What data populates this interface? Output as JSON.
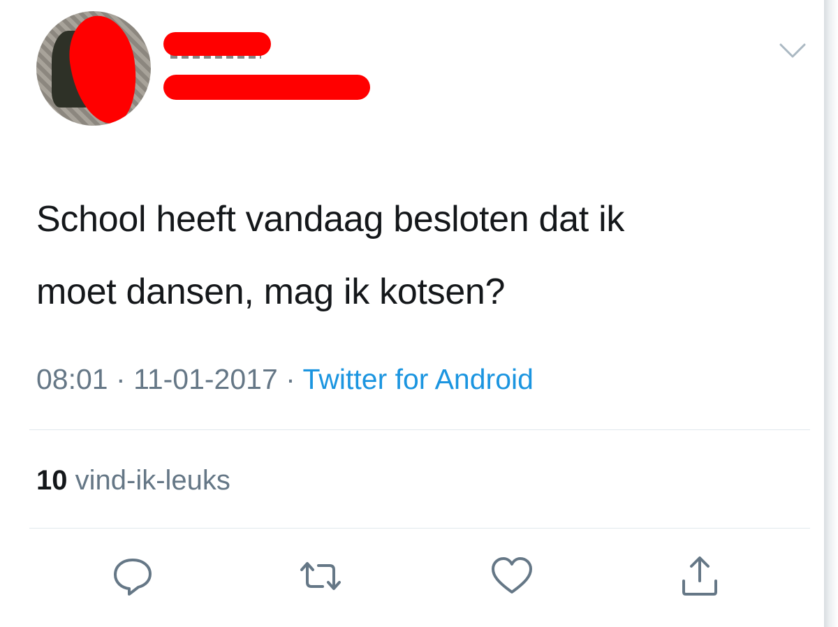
{
  "tweet": {
    "author_name": "",
    "author_handle": "",
    "text_line1": "School heeft vandaag besloten dat ik",
    "text_line2": "moet dansen, mag ik kotsen?",
    "time": "08:01",
    "date": "11-01-2017",
    "separator": "·",
    "source": "Twitter for Android",
    "likes_count": "10",
    "likes_label": "vind-ik-leuks"
  },
  "actions": {
    "reply_icon": "reply-icon",
    "retweet_icon": "retweet-icon",
    "like_icon": "heart-icon",
    "share_icon": "share-icon",
    "menu_icon": "chevron-down-icon"
  },
  "colors": {
    "text": "#14171a",
    "secondary": "#657786",
    "link": "#1b95e0",
    "redaction": "#ff0000",
    "divider": "#e1e8ed"
  }
}
